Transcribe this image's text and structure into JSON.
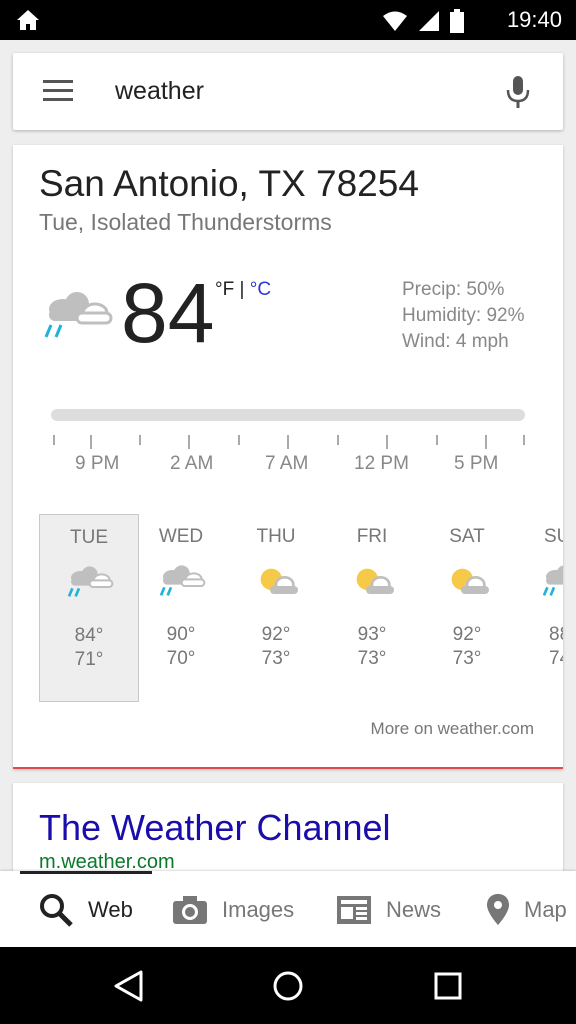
{
  "status": {
    "time": "19:40"
  },
  "search": {
    "query": "weather"
  },
  "weather": {
    "location": "San Antonio, TX 78254",
    "condition": "Tue, Isolated Thunderstorms",
    "temp": "84",
    "unit_f": "°F",
    "unit_sep": "|",
    "unit_c": "°C",
    "precip": "Precip: 50%",
    "humidity": "Humidity: 92%",
    "wind": "Wind: 4 mph",
    "hours": [
      "9 PM",
      "2 AM",
      "7 AM",
      "12 PM",
      "5 PM"
    ],
    "days": [
      {
        "name": "TUE",
        "hi": "84°",
        "lo": "71°",
        "icon": "thunderstorm-icon"
      },
      {
        "name": "WED",
        "hi": "90°",
        "lo": "70°",
        "icon": "thunderstorm-icon"
      },
      {
        "name": "THU",
        "hi": "92°",
        "lo": "73°",
        "icon": "partly-cloudy-icon"
      },
      {
        "name": "FRI",
        "hi": "93°",
        "lo": "73°",
        "icon": "partly-cloudy-icon"
      },
      {
        "name": "SAT",
        "hi": "92°",
        "lo": "73°",
        "icon": "partly-cloudy-icon"
      },
      {
        "name": "SU",
        "hi": "88",
        "lo": "74",
        "icon": "thunderstorm-icon"
      }
    ],
    "more_link": "More on weather.com"
  },
  "result": {
    "title": "The Weather Channel",
    "url": "m.weather.com"
  },
  "tabs": {
    "web": "Web",
    "images": "Images",
    "news": "News",
    "maps": "Map"
  },
  "colors": {
    "accent_blue": "#2a38d4",
    "link": "#1a0dab",
    "url_green": "#0a7a2a",
    "rain": "#1fb3d8",
    "sun": "#f7c948"
  }
}
